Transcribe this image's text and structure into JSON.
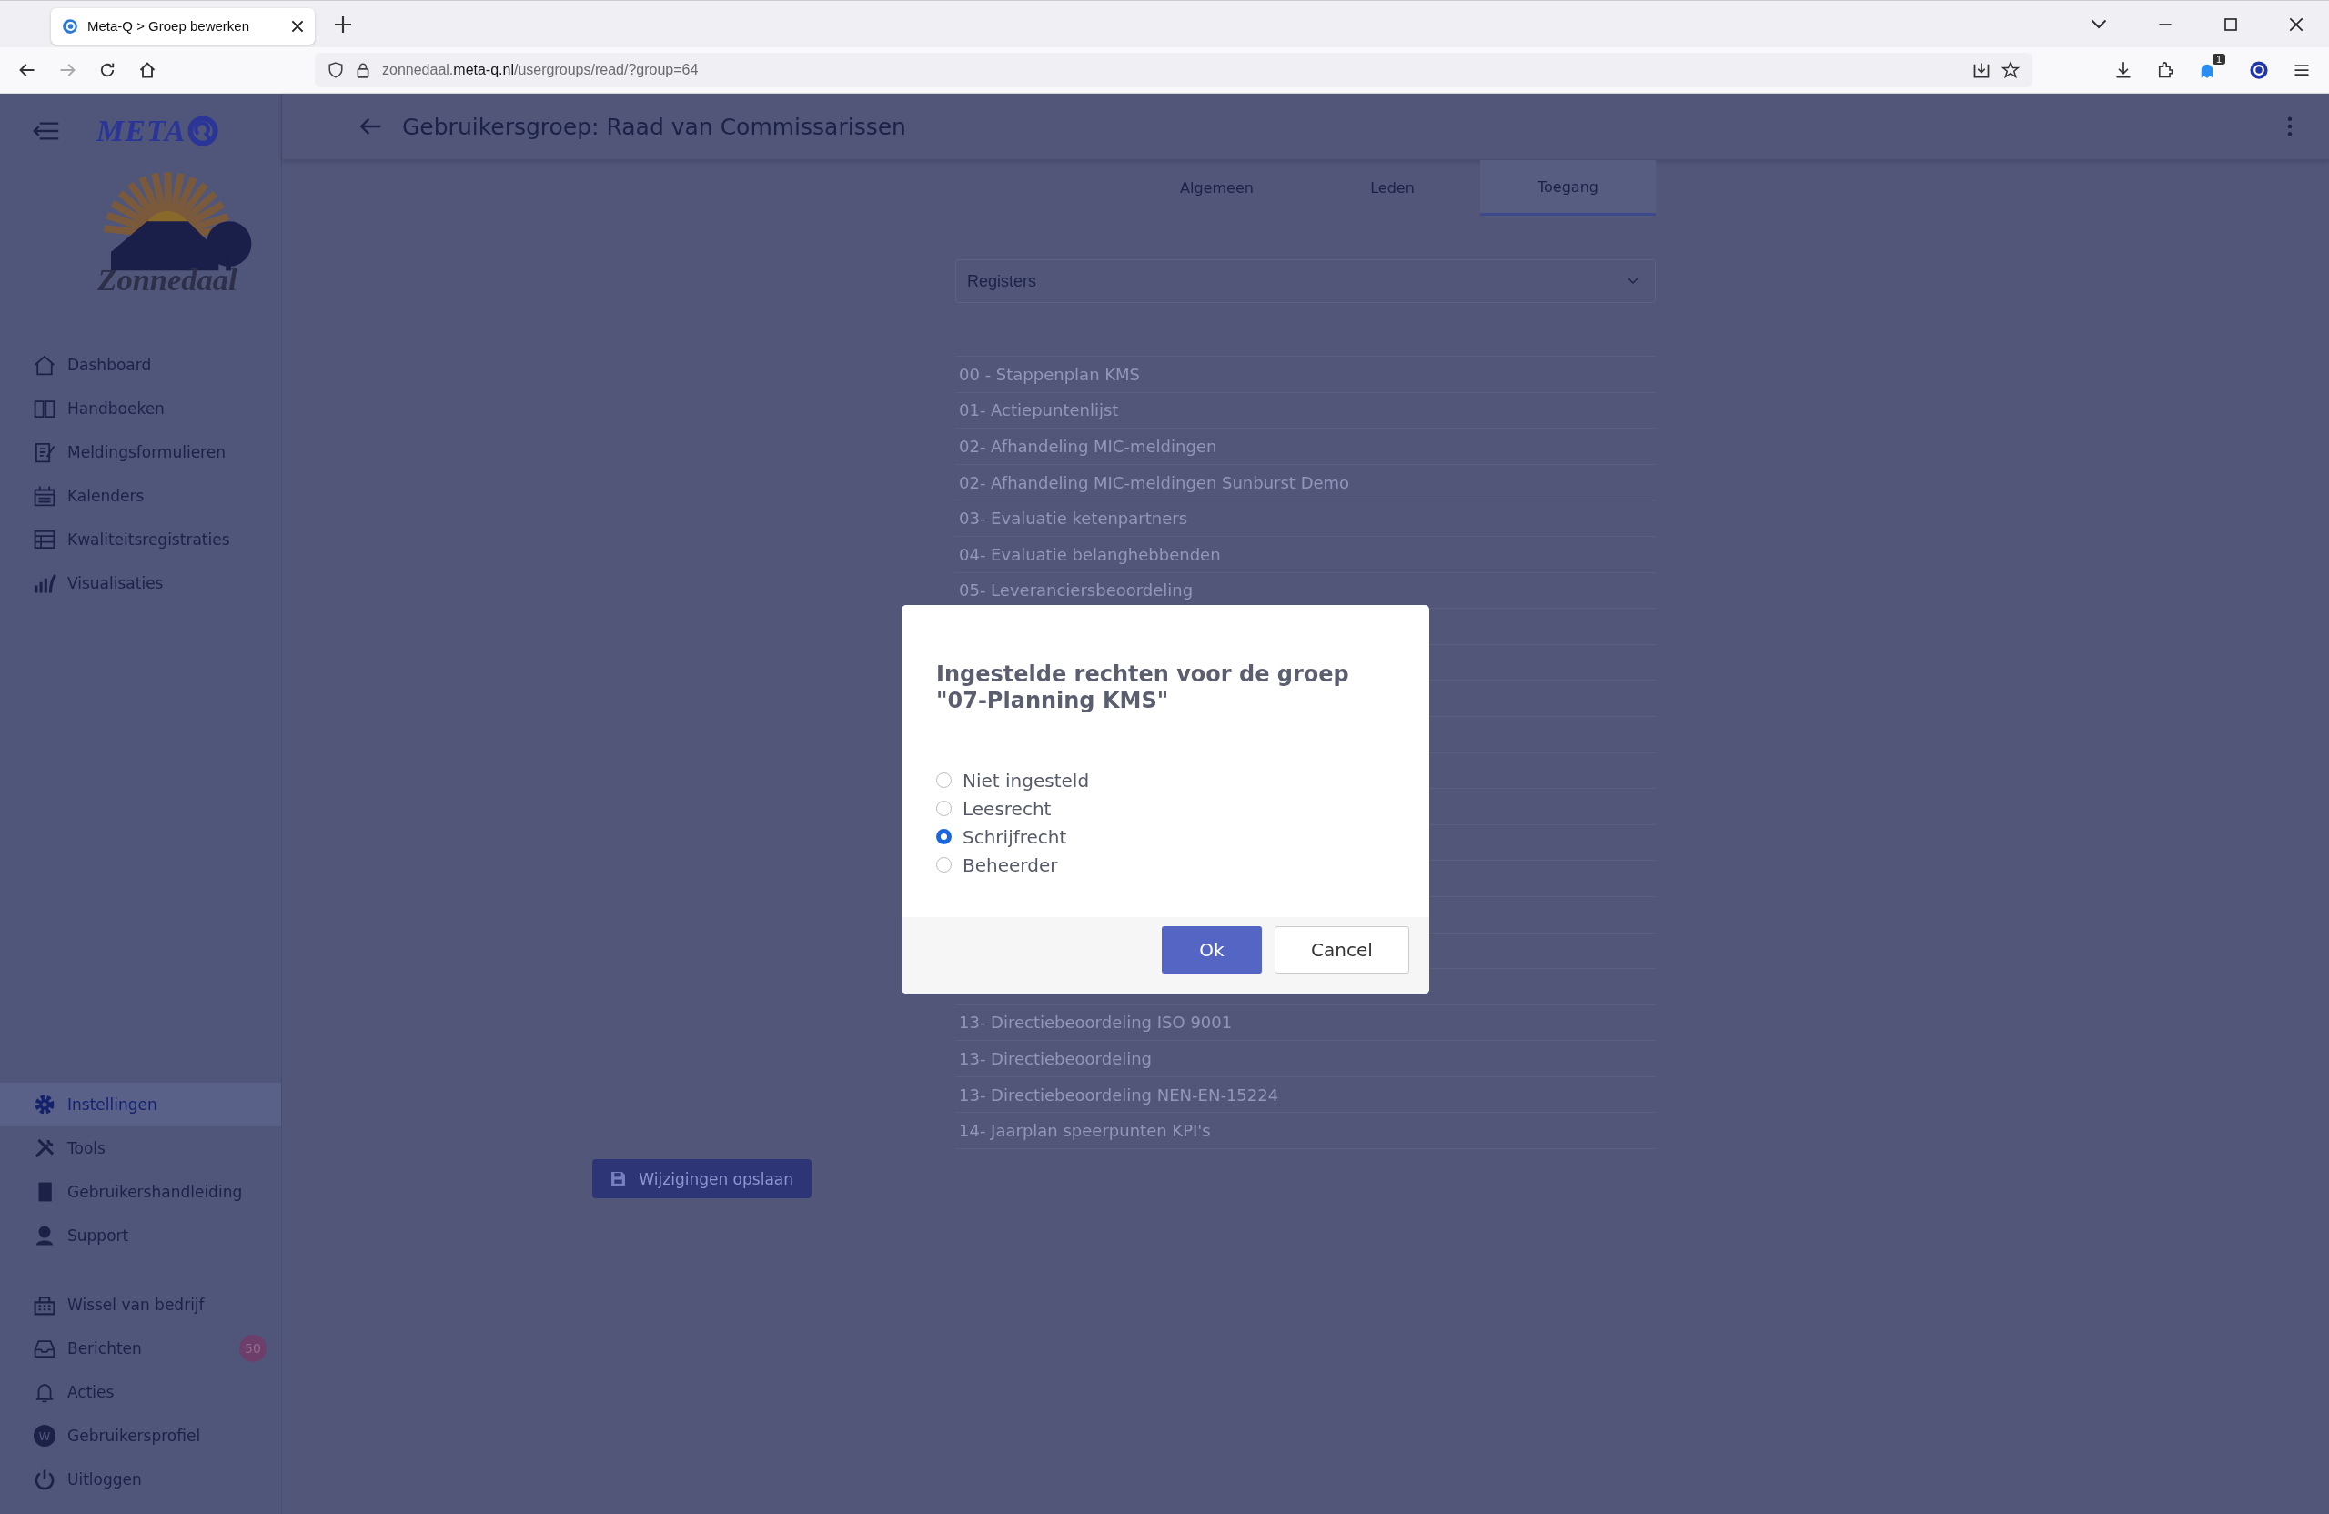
{
  "browser": {
    "tab_title": "Meta-Q > Groep bewerken",
    "url": "zonnedaal.**meta-q.nl**/usergroups/read/?group=64",
    "extension_badge": "1"
  },
  "sidebar": {
    "brand": "META",
    "logo_wordmark": "Zonnedaal",
    "items": [
      {
        "label": "Dashboard",
        "selected": false
      },
      {
        "label": "Handboeken",
        "selected": false
      },
      {
        "label": "Meldingsformulieren",
        "selected": false
      },
      {
        "label": "Kalenders",
        "selected": false
      },
      {
        "label": "Kwaliteitsregistraties",
        "selected": false
      },
      {
        "label": "Visualisaties",
        "selected": false
      }
    ],
    "settings_items": [
      {
        "label": "Instellingen",
        "selected": true
      },
      {
        "label": "Tools",
        "selected": false
      },
      {
        "label": "Gebruikershandleiding",
        "selected": false
      },
      {
        "label": "Support",
        "selected": false
      }
    ],
    "account_items": [
      {
        "label": "Wissel van bedrijf",
        "selected": false
      },
      {
        "label": "Berichten",
        "selected": false,
        "badge": "50"
      },
      {
        "label": "Acties",
        "selected": false
      },
      {
        "label": "Gebruikersprofiel",
        "selected": false,
        "avatar_letter": "W"
      },
      {
        "label": "Uitloggen",
        "selected": false
      }
    ]
  },
  "header": {
    "title": "Gebruikersgroep: Raad van Commissarissen"
  },
  "tabs": [
    {
      "label": "Algemeen",
      "selected": false
    },
    {
      "label": "Leden",
      "selected": false
    },
    {
      "label": "Toegang",
      "selected": true
    }
  ],
  "category_select": {
    "value": "Registers"
  },
  "groups_top": [
    "00 - Stappenplan KMS",
    "01- Actiepuntenlijst",
    "02- Afhandeling MIC-meldingen",
    "02- Afhandeling MIC-meldingen Sunburst Demo",
    "03- Evaluatie ketenpartners",
    "04- Evaluatie belanghebbenden",
    "05- Leveranciersbeoordeling"
  ],
  "groups_bottom": [
    "13- Directiebeoordeling ISO 9001",
    "13- Directiebeoordeling",
    "13- Directiebeoordeling NEN-EN-15224",
    "14- Jaarplan speerpunten KPI's"
  ],
  "save_button": {
    "label": "Wijzigingen opslaan"
  },
  "dialog": {
    "title": "Ingestelde rechten voor de groep \"07-Planning KMS\"",
    "options": [
      {
        "label": "Niet ingesteld",
        "selected": false
      },
      {
        "label": "Leesrecht",
        "selected": false
      },
      {
        "label": "Schrijfrecht",
        "selected": true
      },
      {
        "label": "Beheerder",
        "selected": false
      }
    ],
    "ok": "Ok",
    "cancel": "Cancel"
  }
}
